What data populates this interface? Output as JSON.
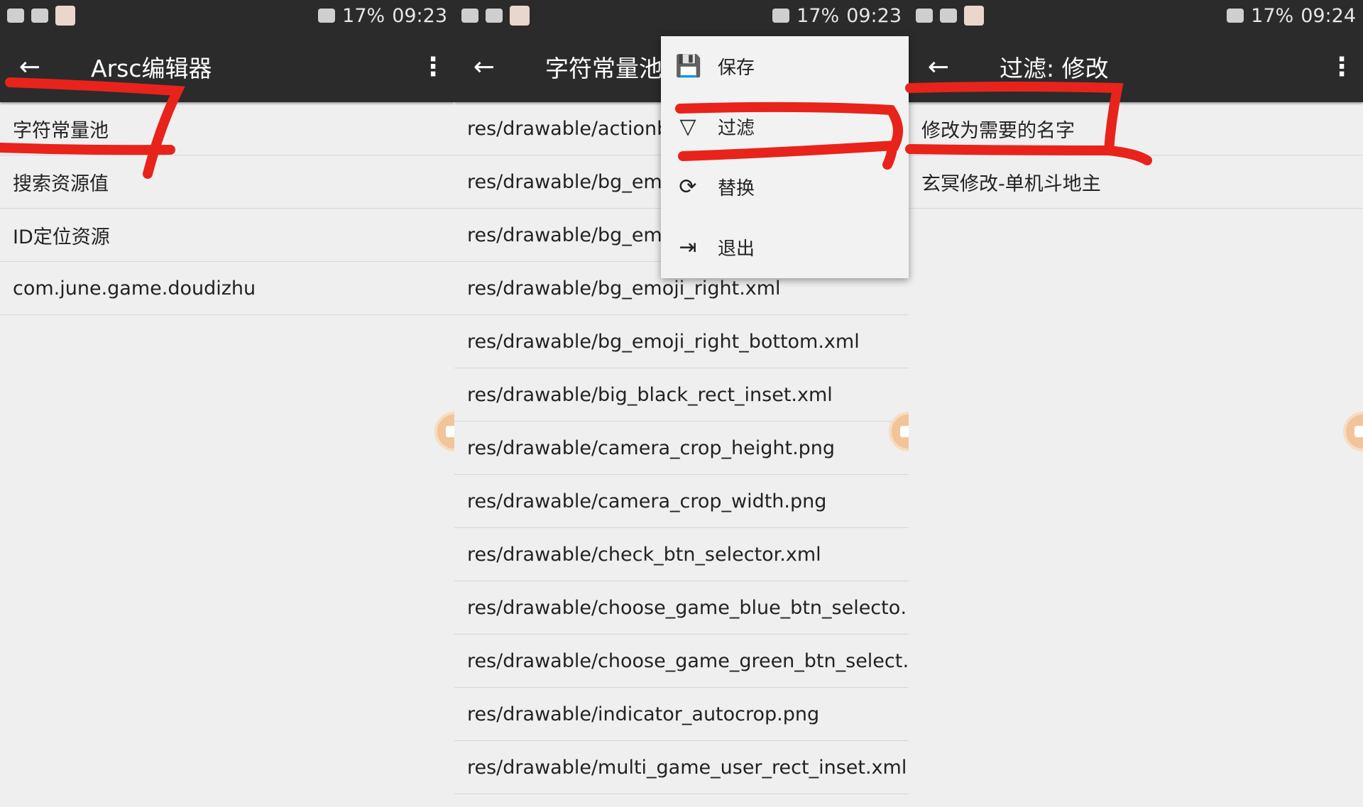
{
  "status_bar": [
    {
      "battery": "17%",
      "time": "09:23"
    },
    {
      "battery": "17%",
      "time": "09:23"
    },
    {
      "battery": "17%",
      "time": "09:24"
    }
  ],
  "panel1": {
    "title": "Arsc编辑器",
    "items": [
      "字符常量池",
      "搜索资源值",
      "ID定位资源",
      "com.june.game.doudizhu"
    ]
  },
  "panel2": {
    "title": "字符常量池",
    "items": [
      "res/drawable/actionb",
      "res/drawable/bg_emc",
      "res/drawable/bg_emc",
      "res/drawable/bg_emoji_right.xml",
      "res/drawable/bg_emoji_right_bottom.xml",
      "res/drawable/big_black_rect_inset.xml",
      "res/drawable/camera_crop_height.png",
      "res/drawable/camera_crop_width.png",
      "res/drawable/check_btn_selector.xml",
      "res/drawable/choose_game_blue_btn_selecto…",
      "res/drawable/choose_game_green_btn_select…",
      "res/drawable/indicator_autocrop.png",
      "res/drawable/multi_game_user_rect_inset.xml"
    ],
    "menu": [
      {
        "label": "保存",
        "icon": "save-icon"
      },
      {
        "label": "过滤",
        "icon": "filter-icon"
      },
      {
        "label": "替换",
        "icon": "replace-icon"
      },
      {
        "label": "退出",
        "icon": "exit-icon"
      }
    ]
  },
  "panel3": {
    "title": "过滤: 修改",
    "items": [
      "修改为需要的名字",
      "玄冥修改-单机斗地主"
    ]
  },
  "annotation_color": "#e8231c"
}
